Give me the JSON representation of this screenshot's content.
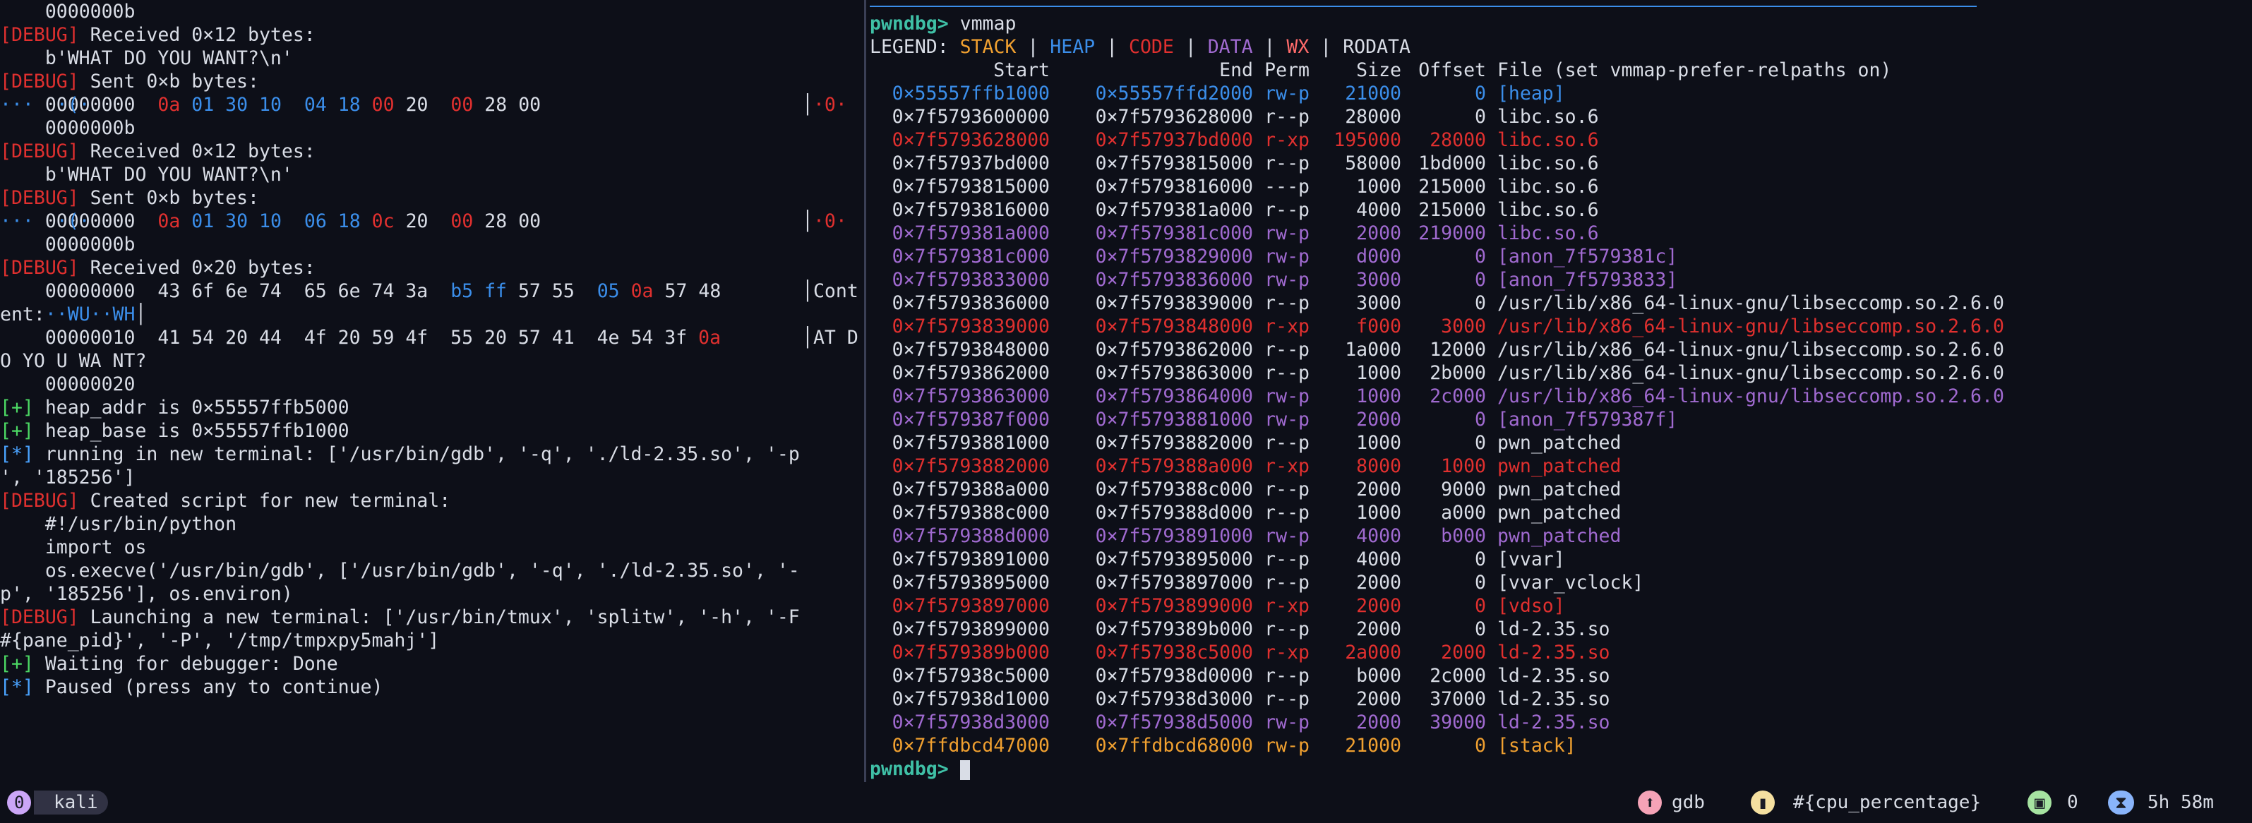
{
  "left": {
    "lines": [
      [
        "",
        "   ",
        " 0000000b"
      ],
      [
        "debug",
        "[DEBUG]",
        " Received 0×12 bytes:"
      ],
      [
        "",
        "",
        "    b'WHAT DO YOU WANT?\\n'"
      ],
      [
        "debug",
        "[DEBUG]",
        " Sent 0×b bytes:"
      ],
      [
        "",
        "",
        "    00000000  "
      ],
      [
        "",
        "",
        "    0000000b"
      ],
      [
        "debug",
        "[DEBUG]",
        " Received 0×12 bytes:"
      ],
      [
        "",
        "",
        "    b'WHAT DO YOU WANT?\\n'"
      ],
      [
        "debug",
        "[DEBUG]",
        " Sent 0×b bytes:"
      ],
      [
        "",
        "",
        "    00000000  "
      ],
      [
        "",
        "",
        "    0000000b"
      ],
      [
        "debug",
        "[DEBUG]",
        " Received 0×20 bytes:"
      ],
      [
        "",
        "",
        "    00000000  43 6f 6e 74  65 6e 74 3a  "
      ],
      [
        "",
        "",
        "ent:"
      ],
      [
        "",
        "",
        "    00000010  41 54 20 44  4f 20 59 4f  55 20 57 41  4e 54 3f "
      ],
      [
        "",
        "",
        "O YO U WA NT?"
      ],
      [
        "",
        "",
        "    00000020"
      ],
      [
        "plus",
        "[+]",
        " heap_addr is 0×55557ffb5000"
      ],
      [
        "plus",
        "[+]",
        " heap_base is 0×55557ffb1000"
      ],
      [
        "star",
        "[*]",
        " running in new terminal: ['/usr/bin/gdb', '-q', './ld-2.35.so', '-p"
      ],
      [
        "",
        "",
        "', '185256']"
      ],
      [
        "debug",
        "[DEBUG]",
        " Created script for new terminal:"
      ],
      [
        "",
        "",
        "    #!/usr/bin/python"
      ],
      [
        "",
        "",
        "    import os"
      ],
      [
        "",
        "",
        "    os.execve('/usr/bin/gdb', ['/usr/bin/gdb', '-q', './ld-2.35.so', '-"
      ],
      [
        "",
        "",
        "p', '185256'], os.environ)"
      ],
      [
        "debug",
        "[DEBUG]",
        " Launching a new terminal: ['/usr/bin/tmux', 'splitw', '-h', '-F"
      ],
      [
        "",
        "",
        "#{pane_pid}', '-P', '/tmp/tmpxpy5mahj']"
      ],
      [
        "plus",
        "[+]",
        " Waiting for debugger: Done"
      ],
      [
        "star",
        "[*]",
        " Paused (press any to continue)"
      ]
    ],
    "hex1": [
      "0a",
      "01",
      "30",
      "10",
      "04",
      "18",
      "00",
      "20",
      "00",
      "28",
      "00"
    ],
    "hex2": [
      "0a",
      "01",
      "30",
      "10",
      "06",
      "18",
      "0c",
      "20",
      "00",
      "28",
      "00"
    ],
    "hex3_tail": [
      "b5",
      "ff",
      "57",
      "55",
      "05",
      "0a",
      "57",
      "48"
    ],
    "dump_side1": "Cont",
    "dump_side2": "AT D",
    "dump_mid1": "··WU··WH",
    "hex4_tail": "0a",
    "sent_side": "·0·",
    "dot_row": "···  ·(·"
  },
  "right": {
    "prompt": "pwndbg>",
    "command": " vmmap",
    "legend_label": "LEGEND: ",
    "legend": [
      "STACK",
      "HEAP",
      "CODE",
      "DATA",
      "WX",
      "RODATA"
    ],
    "headers": [
      "Start",
      "End",
      "Perm",
      "Size",
      "Offset",
      "File (set vmmap-prefer-relpaths on)"
    ],
    "rows": [
      [
        "heap",
        "0×55557ffb1000",
        "0×55557ffd2000",
        "rw-p",
        "21000",
        "0",
        "[heap]"
      ],
      [
        "ro",
        "0×7f5793600000",
        "0×7f5793628000",
        "r--p",
        "28000",
        "0",
        "libc.so.6"
      ],
      [
        "code",
        "0×7f5793628000",
        "0×7f57937bd000",
        "r-xp",
        "195000",
        "28000",
        "libc.so.6"
      ],
      [
        "ro",
        "0×7f57937bd000",
        "0×7f5793815000",
        "r--p",
        "58000",
        "1bd000",
        "libc.so.6"
      ],
      [
        "ro",
        "0×7f5793815000",
        "0×7f5793816000",
        "---p",
        "1000",
        "215000",
        "libc.so.6"
      ],
      [
        "ro",
        "0×7f5793816000",
        "0×7f579381a000",
        "r--p",
        "4000",
        "215000",
        "libc.so.6"
      ],
      [
        "data",
        "0×7f579381a000",
        "0×7f579381c000",
        "rw-p",
        "2000",
        "219000",
        "libc.so.6"
      ],
      [
        "data",
        "0×7f579381c000",
        "0×7f5793829000",
        "rw-p",
        "d000",
        "0",
        "[anon_7f579381c]"
      ],
      [
        "data",
        "0×7f5793833000",
        "0×7f5793836000",
        "rw-p",
        "3000",
        "0",
        "[anon_7f5793833]"
      ],
      [
        "ro",
        "0×7f5793836000",
        "0×7f5793839000",
        "r--p",
        "3000",
        "0",
        "/usr/lib/x86_64-linux-gnu/libseccomp.so.2.6.0"
      ],
      [
        "code",
        "0×7f5793839000",
        "0×7f5793848000",
        "r-xp",
        "f000",
        "3000",
        "/usr/lib/x86_64-linux-gnu/libseccomp.so.2.6.0"
      ],
      [
        "ro",
        "0×7f5793848000",
        "0×7f5793862000",
        "r--p",
        "1a000",
        "12000",
        "/usr/lib/x86_64-linux-gnu/libseccomp.so.2.6.0"
      ],
      [
        "ro",
        "0×7f5793862000",
        "0×7f5793863000",
        "r--p",
        "1000",
        "2b000",
        "/usr/lib/x86_64-linux-gnu/libseccomp.so.2.6.0"
      ],
      [
        "data",
        "0×7f5793863000",
        "0×7f5793864000",
        "rw-p",
        "1000",
        "2c000",
        "/usr/lib/x86_64-linux-gnu/libseccomp.so.2.6.0"
      ],
      [
        "data",
        "0×7f579387f000",
        "0×7f5793881000",
        "rw-p",
        "2000",
        "0",
        "[anon_7f579387f]"
      ],
      [
        "ro",
        "0×7f5793881000",
        "0×7f5793882000",
        "r--p",
        "1000",
        "0",
        "pwn_patched"
      ],
      [
        "code",
        "0×7f5793882000",
        "0×7f579388a000",
        "r-xp",
        "8000",
        "1000",
        "pwn_patched"
      ],
      [
        "ro",
        "0×7f579388a000",
        "0×7f579388c000",
        "r--p",
        "2000",
        "9000",
        "pwn_patched"
      ],
      [
        "ro",
        "0×7f579388c000",
        "0×7f579388d000",
        "r--p",
        "1000",
        "a000",
        "pwn_patched"
      ],
      [
        "data",
        "0×7f579388d000",
        "0×7f5793891000",
        "rw-p",
        "4000",
        "b000",
        "pwn_patched"
      ],
      [
        "ro",
        "0×7f5793891000",
        "0×7f5793895000",
        "r--p",
        "4000",
        "0",
        "[vvar]"
      ],
      [
        "ro",
        "0×7f5793895000",
        "0×7f5793897000",
        "r--p",
        "2000",
        "0",
        "[vvar_vclock]"
      ],
      [
        "code",
        "0×7f5793897000",
        "0×7f5793899000",
        "r-xp",
        "2000",
        "0",
        "[vdso]"
      ],
      [
        "ro",
        "0×7f5793899000",
        "0×7f579389b000",
        "r--p",
        "2000",
        "0",
        "ld-2.35.so"
      ],
      [
        "code",
        "0×7f579389b000",
        "0×7f57938c5000",
        "r-xp",
        "2a000",
        "2000",
        "ld-2.35.so"
      ],
      [
        "ro",
        "0×7f57938c5000",
        "0×7f57938d0000",
        "r--p",
        "b000",
        "2c000",
        "ld-2.35.so"
      ],
      [
        "ro",
        "0×7f57938d1000",
        "0×7f57938d3000",
        "r--p",
        "2000",
        "37000",
        "ld-2.35.so"
      ],
      [
        "data",
        "0×7f57938d3000",
        "0×7f57938d5000",
        "rw-p",
        "2000",
        "39000",
        "ld-2.35.so"
      ],
      [
        "stack",
        "0×7ffdbcd47000",
        "0×7ffdbcd68000",
        "rw-p",
        "21000",
        "0",
        "[stack]"
      ]
    ],
    "prompt_bottom": "pwndbg>"
  },
  "status": {
    "session_index": "0",
    "session_name": "kali",
    "window_name": "gdb",
    "cpu_text": "#{cpu_percentage}",
    "count": "0",
    "uptime": "5h 58m"
  },
  "colors": {
    "stack": "#f0a030",
    "heap": "#3b8eea",
    "code": "#e0302f",
    "data": "#a06ad0",
    "accent_teal": "#3fc0a6",
    "status_pink": "#f5a3b7",
    "status_yellow": "#f5e0a0",
    "status_green": "#a6e3a1",
    "status_blue": "#89b4fa",
    "session_pill": "#cba6f7"
  }
}
